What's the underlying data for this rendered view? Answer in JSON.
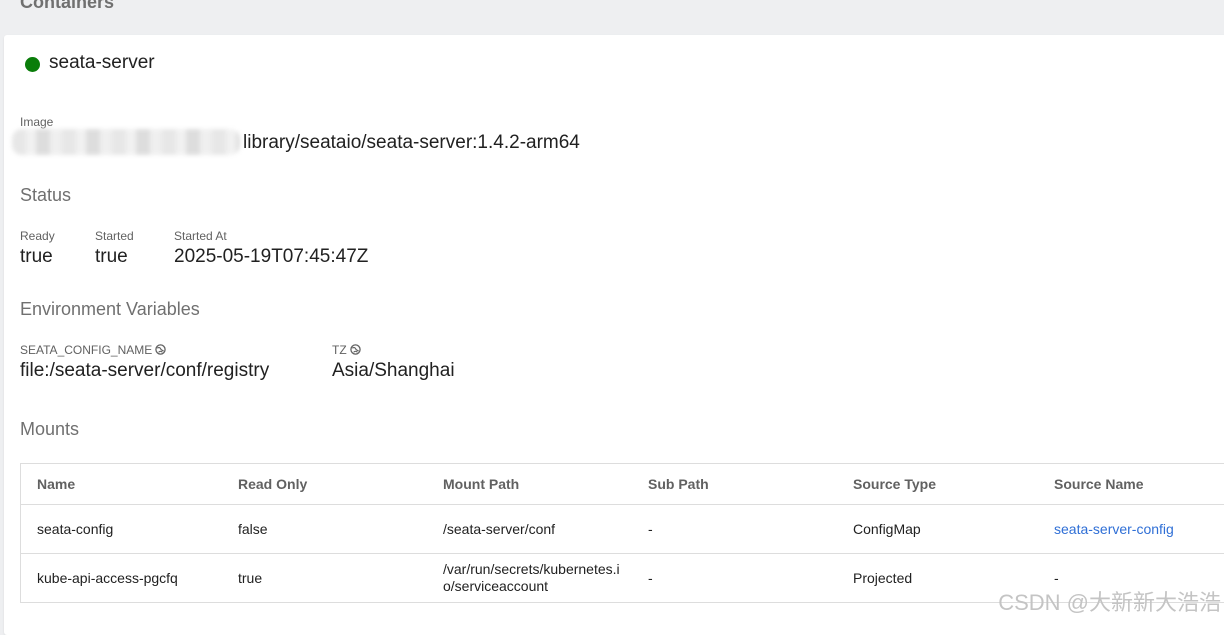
{
  "section_title": "Containers",
  "container": {
    "name": "seata-server",
    "status_color": "#0a7d0a"
  },
  "image": {
    "label": "Image",
    "value": "library/seataio/seata-server:1.4.2-arm64"
  },
  "status": {
    "heading": "Status",
    "fields": [
      {
        "label": "Ready",
        "value": "true"
      },
      {
        "label": "Started",
        "value": "true"
      },
      {
        "label": "Started At",
        "value": "2025-05-19T07:45:47Z"
      }
    ]
  },
  "env": {
    "heading": "Environment Variables",
    "icon": "globe-icon",
    "vars": [
      {
        "name": "SEATA_CONFIG_NAME",
        "value": "file:/seata-server/conf/registry"
      },
      {
        "name": "TZ",
        "value": "Asia/Shanghai"
      }
    ]
  },
  "mounts": {
    "heading": "Mounts",
    "columns": [
      "Name",
      "Read Only",
      "Mount Path",
      "Sub Path",
      "Source Type",
      "Source Name"
    ],
    "rows": [
      [
        "seata-config",
        "false",
        "/seata-server/conf",
        "-",
        "ConfigMap",
        "seata-server-config"
      ],
      [
        "kube-api-access-pgcfq",
        "true",
        "/var/run/secrets/kubernetes.io/serviceaccount",
        "-",
        "Projected",
        "-"
      ]
    ],
    "link_color": "#2f6fd6"
  },
  "watermark": "CSDN @大新新大浩浩"
}
